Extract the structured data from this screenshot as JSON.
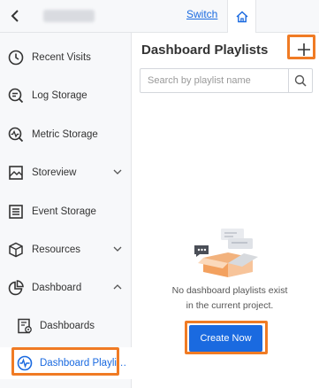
{
  "topbar": {
    "switch_label": "Switch"
  },
  "sidebar": {
    "items": [
      {
        "label": "Recent Visits"
      },
      {
        "label": "Log Storage"
      },
      {
        "label": "Metric Storage"
      },
      {
        "label": "Storeview"
      },
      {
        "label": "Event Storage"
      },
      {
        "label": "Resources"
      },
      {
        "label": "Dashboard"
      },
      {
        "label": "Dashboards"
      },
      {
        "label": "Dashboard Playli…"
      }
    ]
  },
  "main": {
    "title": "Dashboard Playlists",
    "search_placeholder": "Search by playlist name",
    "empty_line1": "No dashboard playlists exist",
    "empty_line2": "in the current project.",
    "create_label": "Create Now"
  },
  "colors": {
    "accent": "#1a6ae0",
    "highlight": "#f07b24",
    "sidebar_bg": "#f7f8fa"
  }
}
